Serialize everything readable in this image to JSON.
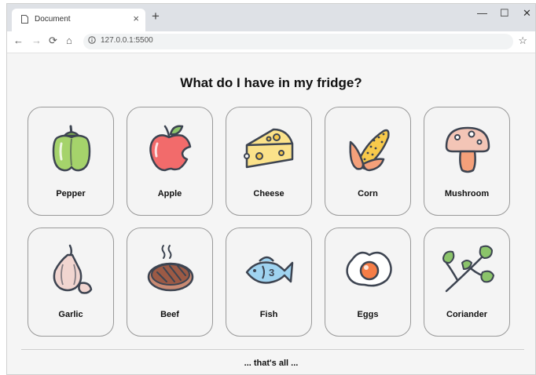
{
  "browser": {
    "tab_title": "Document",
    "tab_close": "×",
    "new_tab": "+",
    "url": "127.0.0.1:5500",
    "controls": {
      "minimize": "—",
      "maximize": "☐",
      "close": "✕"
    },
    "nav": {
      "back": "←",
      "forward": "→",
      "reload": "⟳",
      "home": "⌂",
      "bookmark": "☆"
    }
  },
  "page": {
    "heading": "What do I have in my fridge?",
    "items": [
      {
        "label": "Pepper",
        "icon": "pepper-icon"
      },
      {
        "label": "Apple",
        "icon": "apple-icon"
      },
      {
        "label": "Cheese",
        "icon": "cheese-icon"
      },
      {
        "label": "Corn",
        "icon": "corn-icon"
      },
      {
        "label": "Mushroom",
        "icon": "mushroom-icon"
      },
      {
        "label": "Garlic",
        "icon": "garlic-icon"
      },
      {
        "label": "Beef",
        "icon": "beef-icon"
      },
      {
        "label": "Fish",
        "icon": "fish-icon"
      },
      {
        "label": "Eggs",
        "icon": "eggs-icon"
      },
      {
        "label": "Coriander",
        "icon": "coriander-icon"
      }
    ],
    "footer": "... that's all ..."
  },
  "colors": {
    "outline": "#3d4451",
    "pepper": "#a5d36b",
    "apple": "#f26b6b",
    "cheese": "#fbe28a",
    "corn": "#f7c94b",
    "husk": "#f4a07a",
    "mushroom_cap": "#f3c5b6",
    "garlic": "#f1d5d0",
    "beef": "#9c5a45",
    "fish": "#9fd3f0",
    "egg_yolk": "#f57d47",
    "coriander": "#8bc46a"
  }
}
